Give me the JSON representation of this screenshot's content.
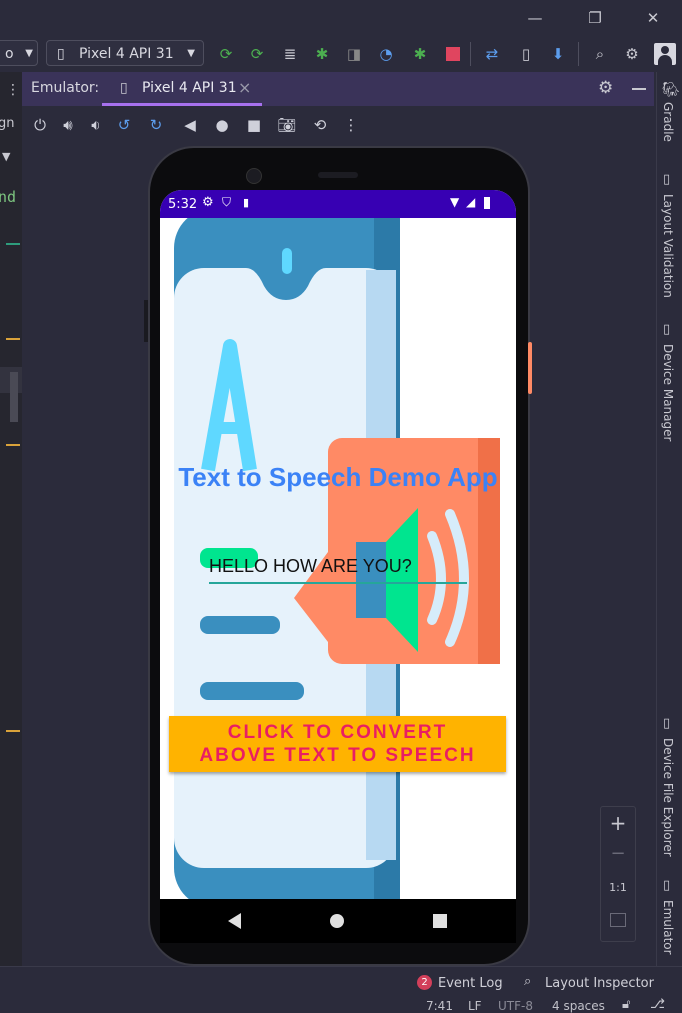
{
  "toolbar": {
    "config_partial": "o",
    "device_selector": "Pixel 4 API 31"
  },
  "emulator_tab": {
    "prefix": "Emulator:",
    "device": "Pixel 4 API 31",
    "close": "×"
  },
  "left_gutter": {
    "fragment_top": "gn",
    "fragment_code": "nd"
  },
  "right_tools": [
    "Gradle",
    "Layout Validation",
    "Device Manager",
    "Device File Explorer",
    "Emulator"
  ],
  "zoom_controls": {
    "zoom_in": "+",
    "zoom_out": "−",
    "one_to_one": "1:1"
  },
  "phone": {
    "status_time": "5:32",
    "app_title": "Text to Speech Demo App",
    "input_value": "HELLO HOW ARE YOU?",
    "convert_button": "CLICK TO CONVERT ABOVE TEXT TO SPEECH"
  },
  "status_bar": {
    "event_count": "2",
    "event_log": "Event Log",
    "layout_inspector": "Layout Inspector",
    "cursor_pos": "7:41",
    "line_sep": "LF",
    "encoding": "UTF-8",
    "indent": "4 spaces"
  },
  "colors": {
    "accent_purple": "#3700b3",
    "title_blue": "#3b82f6",
    "button_yellow": "#ffb300",
    "button_text": "#e91e63",
    "input_underline": "#26a69a",
    "speaker_orange": "#ff8a65"
  }
}
